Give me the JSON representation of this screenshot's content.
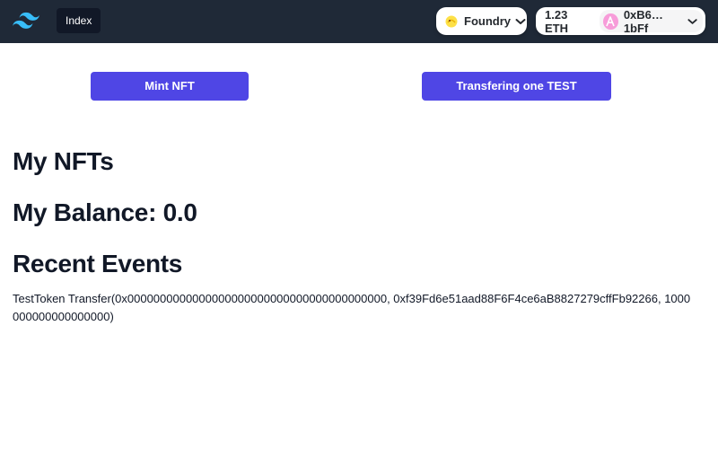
{
  "nav": {
    "index_label": "Index"
  },
  "wallet": {
    "chain_label": "Foundry",
    "balance": "1.23 ETH",
    "address": "0xB6…1bFf",
    "avatar_letter": "A"
  },
  "actions": {
    "mint_label": "Mint NFT",
    "transfer_label": "Transfering one TEST"
  },
  "sections": {
    "nfts_title": "My NFTs",
    "balance_title": "My Balance: 0.0",
    "events_title": "Recent Events"
  },
  "events": [
    "TestToken Transfer(0x0000000000000000000000000000000000000000, 0xf39Fd6e51aad88F6F4ce6aB8827279cffFb92266, 1000000000000000000)"
  ],
  "colors": {
    "topbar": "#1f2937",
    "accent": "#4f46e5",
    "logo": "#38bdf8"
  },
  "icons": {
    "logo": "tailwind-logo-icon",
    "chain": "foundry-chain-icon",
    "chevron": "chevron-down-icon"
  }
}
